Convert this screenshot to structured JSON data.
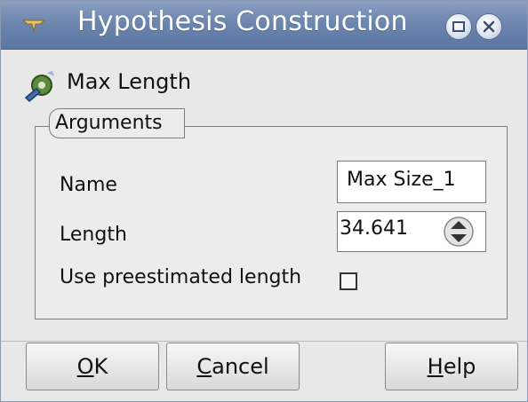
{
  "window": {
    "title": "Hypothesis Construction",
    "maximize_icon": "maximize-icon",
    "close_icon": "close-icon",
    "accent": "#6d86ae"
  },
  "algorithm": {
    "name": "Max Length",
    "icon": "hypothesis-gear-icon"
  },
  "arguments": {
    "group_label": "Arguments",
    "name_label": "Name",
    "name_value": "Max Size_1",
    "length_label": "Length",
    "length_value": "34.641",
    "preestimated_label": "Use preestimated length",
    "preestimated_checked": false
  },
  "buttons": {
    "ok_mnemonic": "O",
    "ok_rest": "K",
    "cancel_mnemonic": "C",
    "cancel_rest": "ancel",
    "help_mnemonic": "H",
    "help_rest": "elp"
  }
}
